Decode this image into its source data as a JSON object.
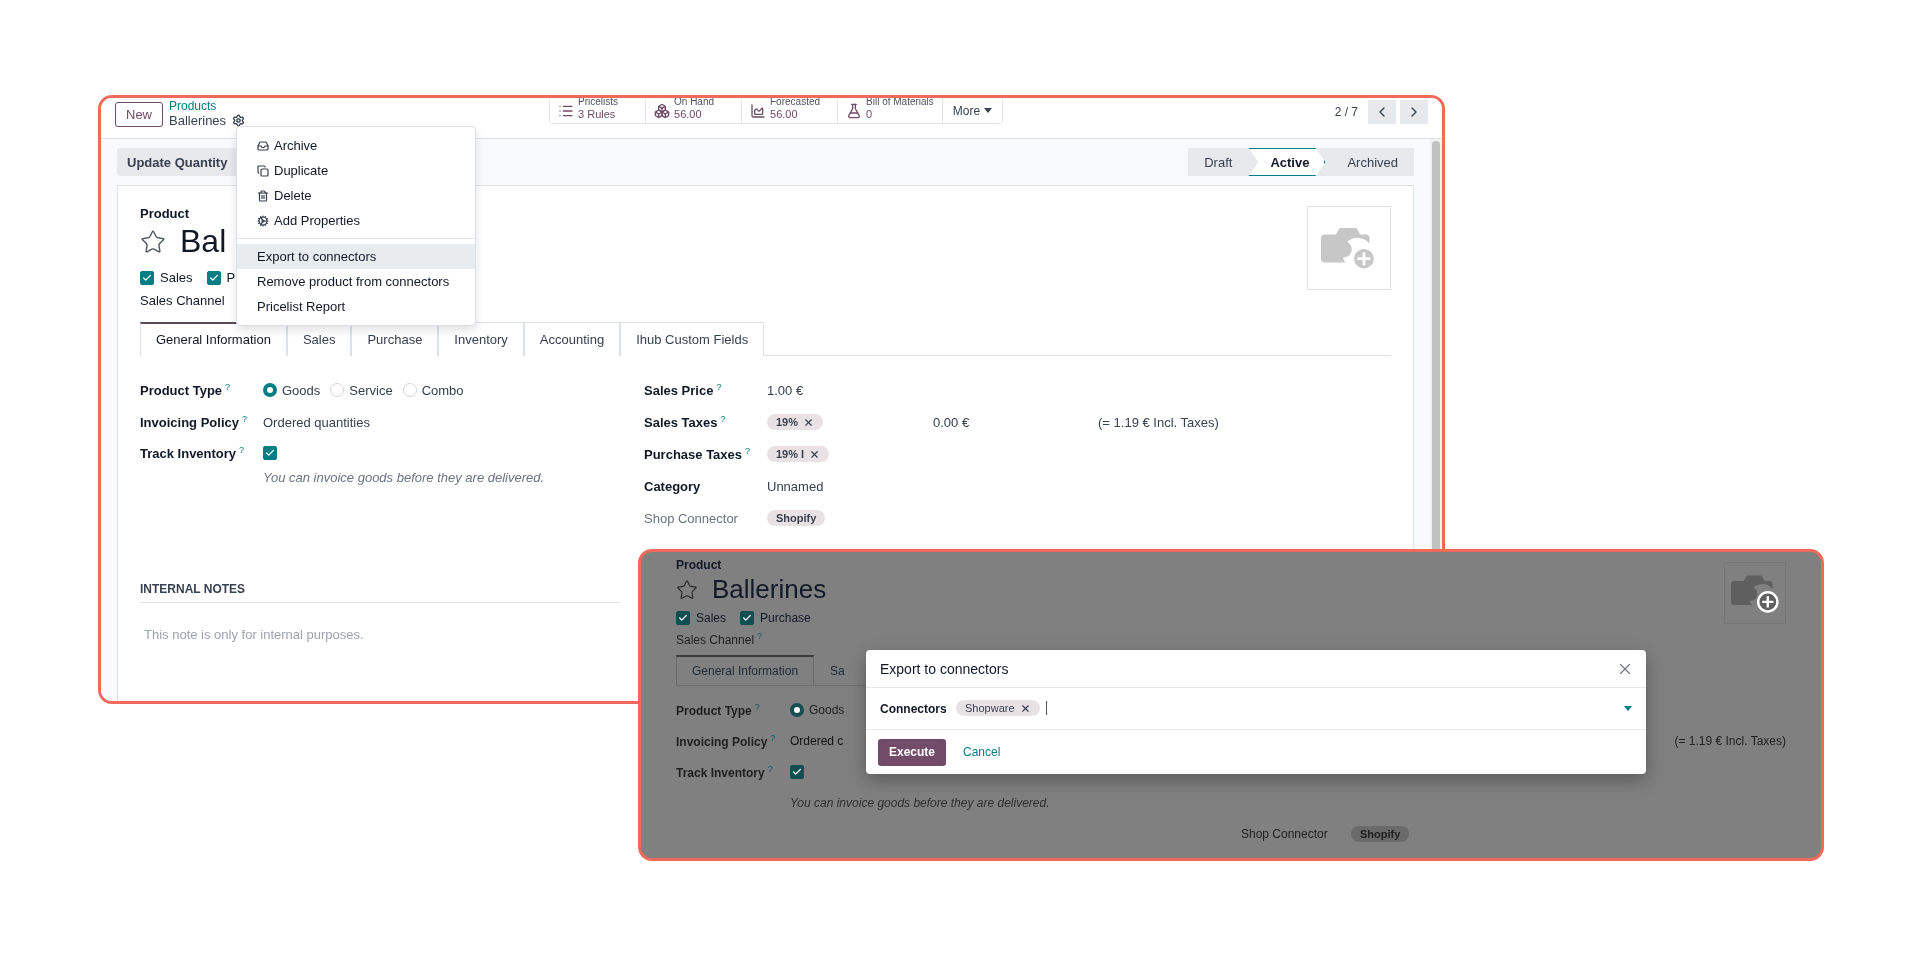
{
  "form_view": {
    "control_panel": {
      "new_button": "New",
      "breadcrumb": "Products",
      "record_name": "Ballerines",
      "stat_buttons": [
        {
          "label": "Pricelists",
          "value": "3 Rules"
        },
        {
          "label": "On Hand",
          "value": "56.00"
        },
        {
          "label": "Forecasted",
          "value": "56.00"
        },
        {
          "label": "Bill of Materials",
          "value": "0"
        }
      ],
      "more_button": "More",
      "pager": "2 / 7"
    },
    "action_buttons": [
      "Update Quantity"
    ],
    "status_stages": [
      {
        "label": "Draft",
        "selected": false
      },
      {
        "label": "Active",
        "selected": true
      },
      {
        "label": "Archived",
        "selected": false
      }
    ],
    "sheet": {
      "caption": "Product",
      "title": "Bal",
      "checkboxes": [
        {
          "label": "Sales",
          "checked": true
        },
        {
          "label": "P",
          "checked": true
        }
      ],
      "channel_label": "Sales Channel",
      "tabs": [
        {
          "label": "General Information",
          "selected": true
        },
        {
          "label": "Sales",
          "selected": false
        },
        {
          "label": "Purchase",
          "selected": false
        },
        {
          "label": "Inventory",
          "selected": false
        },
        {
          "label": "Accounting",
          "selected": false
        },
        {
          "label": "Ihub Custom Fields",
          "selected": false
        }
      ],
      "left_fields": [
        {
          "kind": "radio",
          "label": "Product Type",
          "help": "?",
          "options": [
            {
              "label": "Goods",
              "selected": true
            },
            {
              "label": "Service",
              "selected": false
            },
            {
              "label": "Combo",
              "selected": false
            }
          ]
        },
        {
          "kind": "text",
          "label": "Invoicing Policy",
          "help": "?",
          "value": "Ordered quantities"
        },
        {
          "kind": "checkbox",
          "label": "Track Inventory",
          "help": "?",
          "checked": true
        }
      ],
      "hint": "You can invoice goods before they are delivered.",
      "right_fields": [
        {
          "kind": "text",
          "label": "Sales Price",
          "help": "?",
          "value": "1.00 €"
        },
        {
          "kind": "tags",
          "label": "Sales Taxes",
          "help": "?",
          "tags": [
            {
              "label": "19%",
              "removable": true
            }
          ],
          "amount": "0.00 €",
          "total": "(= 1.19 € Incl. Taxes)"
        },
        {
          "kind": "tags",
          "label": "Purchase Taxes",
          "help": "?",
          "tags": [
            {
              "label": "19% I",
              "removable": true
            }
          ]
        },
        {
          "kind": "text",
          "label": "Category",
          "value": "Unnamed"
        },
        {
          "kind": "tags",
          "label": "Shop Connector",
          "muted": true,
          "tags": [
            {
              "label": "Shopify",
              "removable": false
            }
          ]
        }
      ],
      "notes_heading": "INTERNAL NOTES",
      "notes_placeholder": "This note is only for internal purposes."
    }
  },
  "gear_menu": {
    "sections": [
      {
        "items": [
          {
            "label": "Archive",
            "selected": false
          },
          {
            "label": "Duplicate",
            "selected": false
          },
          {
            "label": "Delete",
            "selected": false
          },
          {
            "label": "Add Properties",
            "selected": false
          }
        ]
      },
      {
        "items": [
          {
            "label": "Export to connectors",
            "selected": true
          },
          {
            "label": "Remove product from connectors",
            "selected": false
          },
          {
            "label": "Pricelist Report",
            "selected": false
          }
        ]
      }
    ]
  },
  "dialog_view": {
    "sheet": {
      "caption": "Product",
      "title": "Ballerines",
      "checkboxes": [
        {
          "label": "Sales",
          "checked": true
        },
        {
          "label": "Purchase",
          "checked": true
        }
      ],
      "channel_label": "Sales Channel",
      "channel_help": "?",
      "tabs": [
        {
          "label": "General Information",
          "selected": true
        },
        {
          "label": "Sa",
          "selected": false
        }
      ],
      "left_fields": [
        {
          "kind": "radio",
          "label": "Product Type",
          "help": "?",
          "options": [
            {
              "label": "Goods",
              "selected": true
            }
          ]
        },
        {
          "kind": "text",
          "label": "Invoicing Policy",
          "help": "?",
          "value": "Ordered c"
        },
        {
          "kind": "checkbox",
          "label": "Track Inventory",
          "help": "?",
          "checked": true
        }
      ],
      "hint": "You can invoice goods before they are delivered.",
      "total": "(= 1.19 € Incl. Taxes)",
      "shop_connector": {
        "label": "Shop Connector",
        "tag": "Shopify"
      }
    },
    "modal": {
      "title": "Export to connectors",
      "field_label": "Connectors",
      "tags": [
        {
          "label": "Shopware",
          "removable": true
        }
      ],
      "buttons": [
        {
          "label": "Execute",
          "kind": "primary"
        },
        {
          "label": "Cancel",
          "kind": "link"
        }
      ]
    }
  }
}
